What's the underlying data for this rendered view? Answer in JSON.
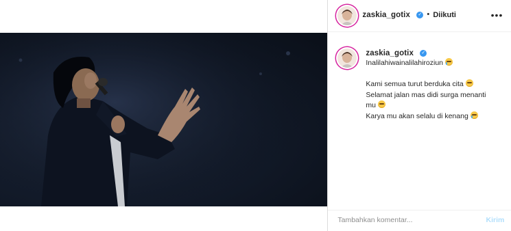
{
  "post": {
    "username": "zaskia_gotix",
    "separator": "•",
    "follow_status": "Diikuti",
    "more_icon": "ellipsis-icon",
    "verified_icon": "verified-badge-icon"
  },
  "caption": {
    "username": "zaskia_gotix",
    "lines": [
      "Inalilahiwainalilahiroziun",
      "",
      "Kami semua turut berduka cita",
      "Selamat jalan mas didi surga menanti",
      "mu",
      "Karya mu akan selalu di kenang"
    ]
  },
  "comment": {
    "placeholder": "Tambahkan komentar...",
    "post_label": "Kirim"
  },
  "colors": {
    "accent": "#3897f0",
    "story_ring": "#d6249f",
    "post_disabled": "#b2dffc",
    "photo_bg": "#121a29"
  }
}
